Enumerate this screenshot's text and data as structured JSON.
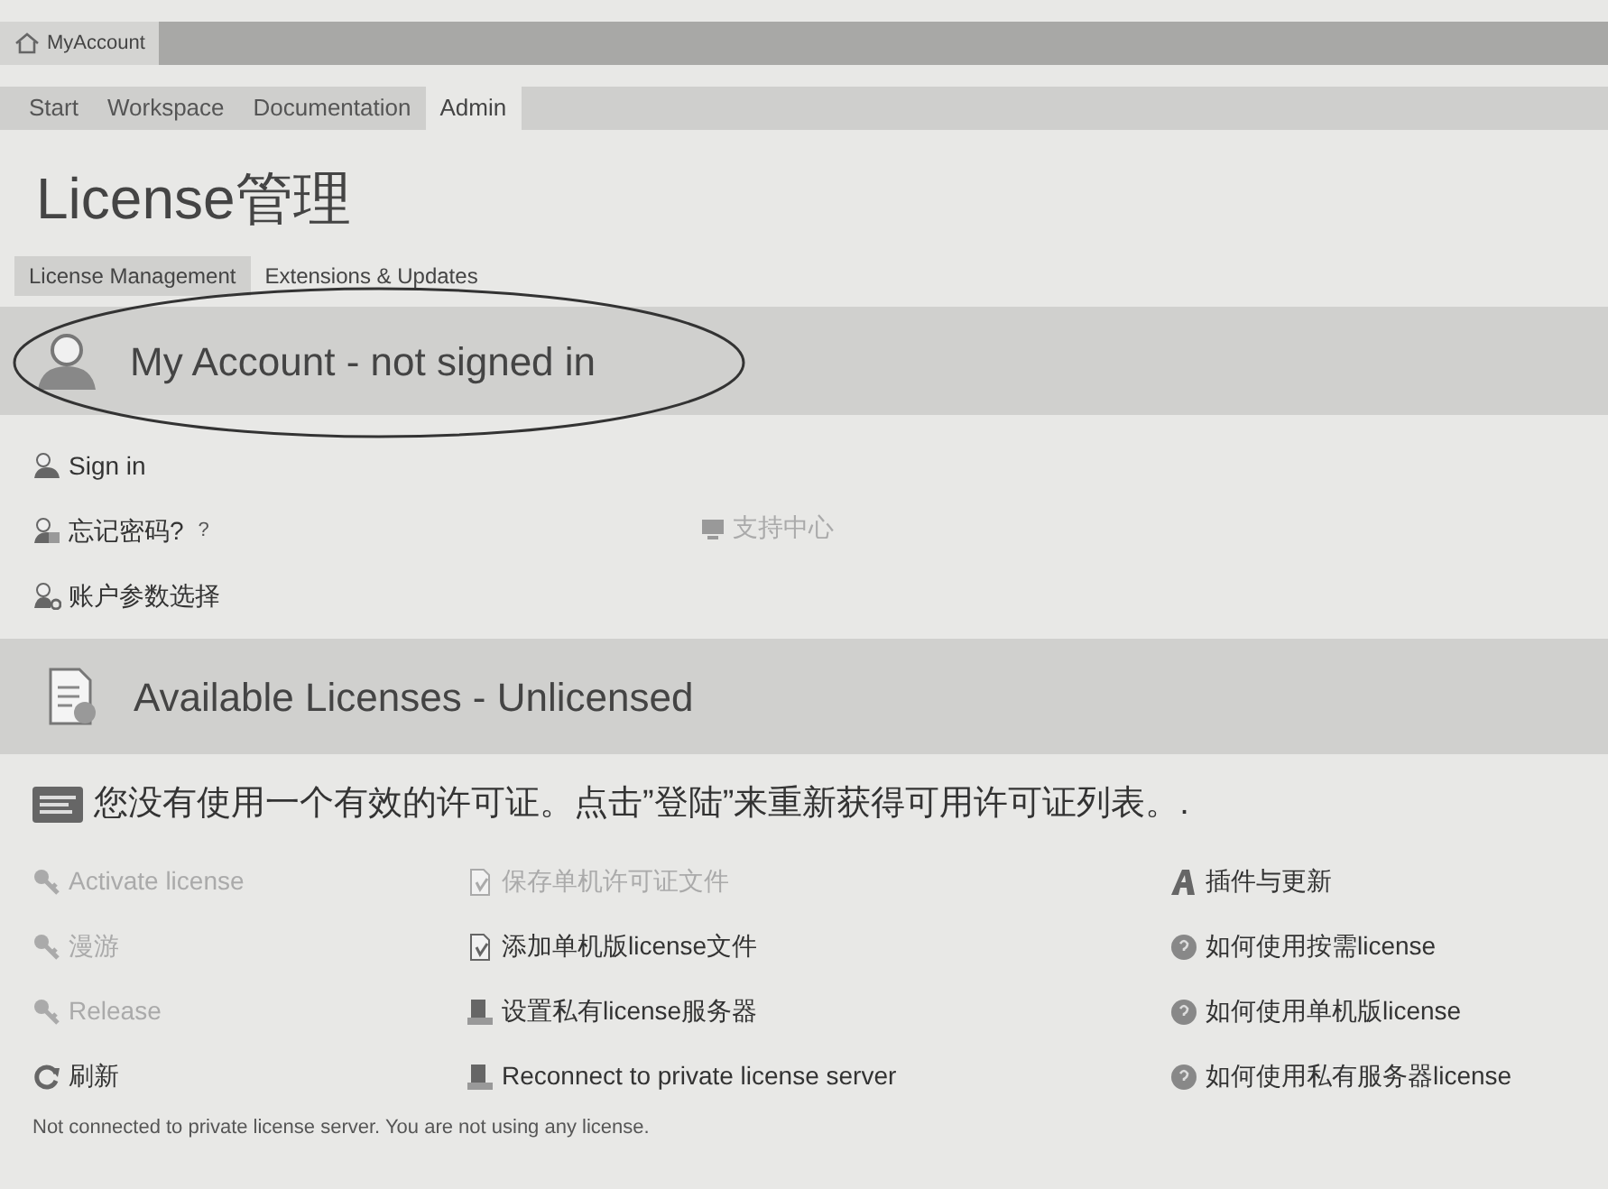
{
  "window": {
    "tab": "MyAccount"
  },
  "menu": [
    {
      "label": "Start",
      "selected": false
    },
    {
      "label": "Workspace",
      "selected": false
    },
    {
      "label": "Documentation",
      "selected": false
    },
    {
      "label": "Admin",
      "selected": true
    }
  ],
  "page_title": "License管理",
  "subtabs": [
    {
      "label": "License Management",
      "selected": true
    },
    {
      "label": "Extensions & Updates",
      "selected": false
    }
  ],
  "account": {
    "title": "My Account - not signed in",
    "links": [
      {
        "label": "Sign in",
        "kind": "user",
        "disabled": false
      },
      {
        "label": "忘记密码?",
        "suffix": "?",
        "kind": "user-lock",
        "disabled": false
      },
      {
        "label": "账户参数选择",
        "kind": "user-settings",
        "disabled": false
      }
    ],
    "support": {
      "label": "支持中心",
      "disabled": true
    }
  },
  "licenses": {
    "title": "Available Licenses - Unlicensed",
    "message": "您没有使用一个有效的许可证。点击”登陆”来重新获得可用许可证列表。.",
    "columns": [
      [
        {
          "label": "Activate license",
          "kind": "key",
          "disabled": true
        },
        {
          "label": "漫游",
          "kind": "key",
          "disabled": true
        },
        {
          "label": "Release",
          "kind": "key",
          "disabled": true
        },
        {
          "label": "刷新",
          "kind": "refresh",
          "disabled": false
        }
      ],
      [
        {
          "label": "保存单机许可证文件",
          "kind": "file",
          "disabled": true
        },
        {
          "label": "添加单机版license文件",
          "kind": "file",
          "disabled": false
        },
        {
          "label": "设置私有license服务器",
          "kind": "server",
          "disabled": false
        },
        {
          "label": "Reconnect to private license server",
          "kind": "server",
          "disabled": false
        }
      ],
      [
        {
          "label": "插件与更新",
          "kind": "plugin",
          "disabled": false
        },
        {
          "label": "如何使用按需license",
          "kind": "help",
          "disabled": false
        },
        {
          "label": "如何使用单机版license",
          "kind": "help",
          "disabled": false
        },
        {
          "label": "如何使用私有服务器license",
          "kind": "help",
          "disabled": false
        }
      ]
    ]
  },
  "status": "Not connected to private license server. You are not using any license."
}
